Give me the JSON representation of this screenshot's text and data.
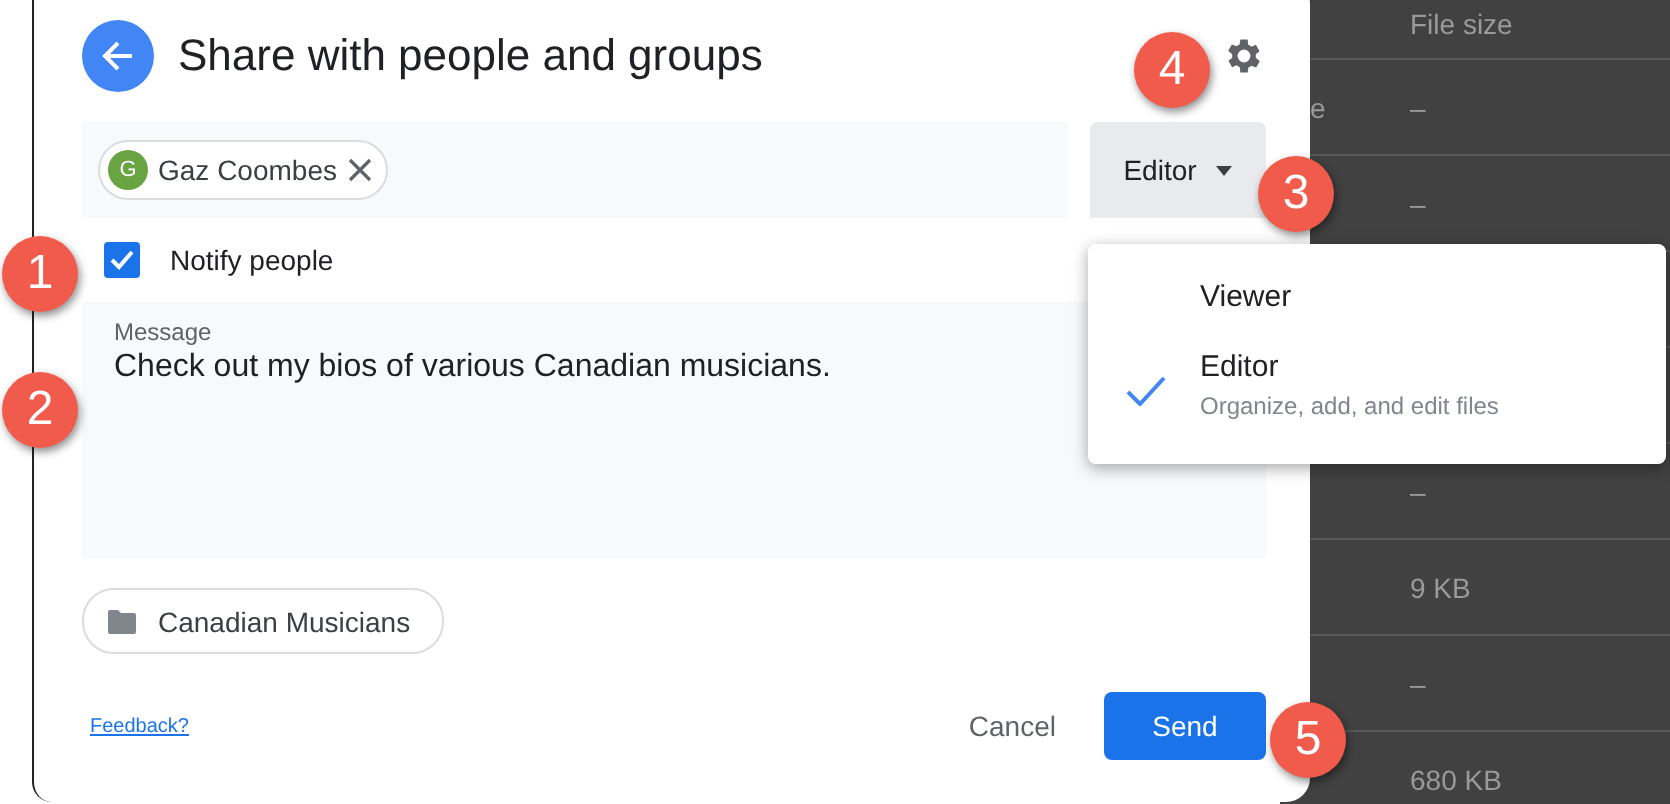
{
  "background_table": {
    "header": "File size",
    "rows": [
      {
        "column_1": "e",
        "file_size": "–"
      },
      {
        "file_size": "–"
      },
      {},
      {},
      {
        "file_size": "–"
      },
      {
        "file_size": "9 KB"
      },
      {
        "file_size": "–"
      },
      {
        "file_size": "680 KB"
      }
    ]
  },
  "dialog": {
    "title": "Share with people and groups",
    "recipients": [
      {
        "initial": "G",
        "name": "Gaz Coombes"
      }
    ],
    "role_dropdown": {
      "value": "Editor",
      "expanded": true
    },
    "notify": {
      "label": "Notify people",
      "checked": true
    },
    "message": {
      "label": "Message",
      "value": "Check out my bios of various Canadian musicians."
    },
    "folder_chip": {
      "label": "Canadian Musicians"
    },
    "feedback_link": "Feedback?",
    "buttons": [
      {
        "kind": "text",
        "label": "Cancel"
      },
      {
        "kind": "primary",
        "label": "Send"
      }
    ]
  },
  "role_menu": {
    "items": [
      {
        "label": "Viewer",
        "selected": false
      },
      {
        "label": "Editor",
        "description": "Organize, add, and edit files",
        "selected": true
      }
    ]
  },
  "callouts": [
    "1",
    "2",
    "3",
    "4",
    "5"
  ]
}
